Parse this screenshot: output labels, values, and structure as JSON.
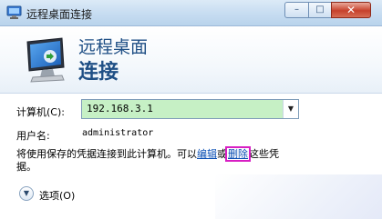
{
  "window": {
    "title": "远程桌面连接",
    "minimize_glyph": "–",
    "maximize_glyph": "□",
    "close_glyph": "✕"
  },
  "banner": {
    "line1": "远程桌面",
    "line2": "连接"
  },
  "form": {
    "computer_label": "计算机(C):",
    "computer_value": "192.168.3.1",
    "user_label": "用户名:",
    "user_value": "administrator",
    "notice_prefix": "将使用保存的凭据连接到此计算机。可以",
    "edit_link": "编辑",
    "notice_or": "或",
    "delete_link": "删除",
    "notice_suffix": "这些凭据。"
  },
  "options": {
    "label": "选项(O)",
    "icon": "chevron-down-icon"
  },
  "colors": {
    "combo_fill": "#c6f0c5",
    "link": "#0b4fb4",
    "highlight": "#d81fc3",
    "banner_text": "#1f4f85"
  }
}
